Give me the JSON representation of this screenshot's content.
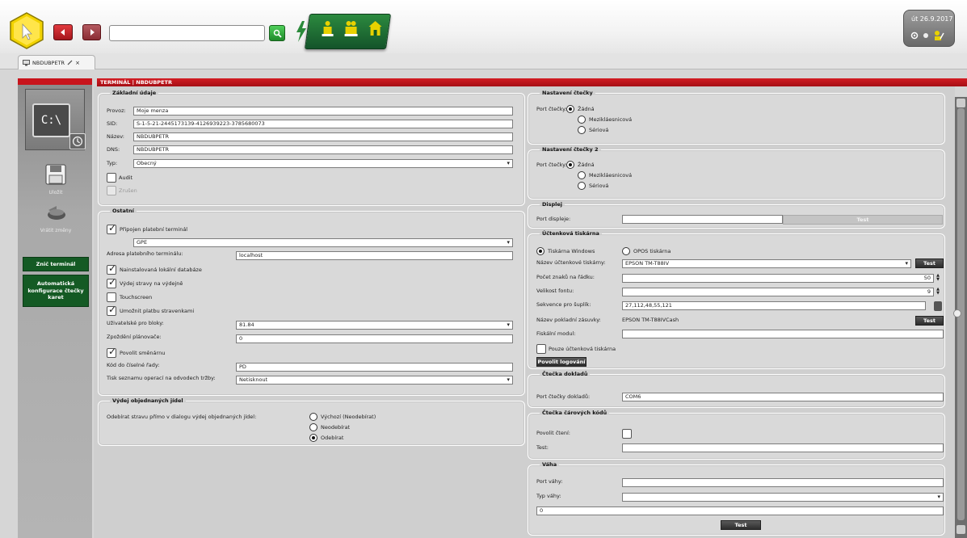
{
  "toolbar": {
    "search_value": ""
  },
  "clock": {
    "date": "út 26.9.2017"
  },
  "tabs": [
    {
      "label": "NBDUBPETR"
    }
  ],
  "sidebar": {
    "terminal_icon_text": "C:\\",
    "save_label": "Uložit",
    "undo_label": "Vrátit změny",
    "own_terminal_label": "Znič terminál",
    "auto_config_label": "Automatická konfigurace čtečky karet"
  },
  "header": {
    "title": "TERMINÁL | NBDUBPETR"
  },
  "basic": {
    "legend": "Základní údaje",
    "provoz_label": "Provoz:",
    "provoz_value": "Moje menza",
    "sid_label": "SID:",
    "sid_value": "S-1-5-21-2445173139-4126939223-3785680073",
    "nazev_label": "Název:",
    "nazev_value": "NBDUBPETR",
    "dns_label": "DNS:",
    "dns_value": "NBDUBPETR",
    "typ_label": "Typ:",
    "typ_value": "Obecný",
    "audit_label": "Audit",
    "zrusen_label": "Zrušen"
  },
  "other": {
    "legend": "Ostatní",
    "payment_label": "Připojen platební terminál",
    "payment_type": "GPE",
    "address_label": "Adresa platebního terminálu:",
    "address_value": "localhost",
    "localdb_label": "Nainstalovaná lokální databáze",
    "issue_label": "Výdej stravy na výdejně",
    "touch_label": "Touchscreen",
    "allow_pay_label": "Umožnit platbu stravenkami",
    "blocks_label": "Uživatelské pro bloky:",
    "blocks_value": "81.84",
    "delay_label": "Zpoždění plánovače:",
    "delay_value": "0",
    "shift_label": "Povolit směnárnu",
    "series_label": "Kód do číselné řady:",
    "series_value": "PD",
    "print_label": "Tisk seznamu operací na odvodech tržby:",
    "print_value": "Netisknout"
  },
  "orders": {
    "legend": "Výdej objednaných jídel",
    "question": "Odebírat stravu přímo v dialogu výdej objednaných jídel:",
    "options": [
      "Výchozí (Neodebírat)",
      "Neodebírat",
      "Odebírat"
    ]
  },
  "reader1": {
    "legend": "Nastavení čtečky",
    "port_label": "Port čtečky:",
    "options": [
      "Žádná",
      "Mezikláesnicová",
      "Sériová"
    ]
  },
  "reader2": {
    "legend": "Nastavení čtečky 2",
    "port_label": "Port čtečky:",
    "options": [
      "Žádná",
      "Mezikláesnicová",
      "Sériová"
    ]
  },
  "display": {
    "legend": "Displej",
    "port_label": "Port displeje:",
    "test_label": "Test"
  },
  "printer": {
    "legend": "Účtenková tiskárna",
    "opt_windows": "Tiskárna Windows",
    "opt_opos": "OPOS tiskárna",
    "name_label": "Název účtenkové tiskárny:",
    "name_value": "EPSON TM-T88IV",
    "test_label": "Test",
    "chars_label": "Počet znaků na řádku:",
    "chars_value": "50",
    "font_label": "Velikost fontu:",
    "font_value": "9",
    "seq_label": "Sekvence pro šuplík:",
    "seq_value": "27,112,48,55,121",
    "drawer_label": "Název pokladní zásuvky:",
    "drawer_value": "EPSON TM-T88IVCash",
    "fiscal_label": "Fiskální modul:",
    "only_label": "Pouze účtenková tiskárna",
    "logo_label": "Povolit logování"
  },
  "doc_reader": {
    "legend": "Čtečka dokladů",
    "port_label": "Port čtečky dokladů:",
    "port_value": "COM6"
  },
  "barcode": {
    "legend": "Čtečka čárových kódů",
    "allow_label": "Povolit čtení:",
    "test_label": "Test:"
  },
  "scale": {
    "legend": "Váha",
    "port_label": "Port váhy:",
    "type_label": "Typ váhy:",
    "extra_value": "0",
    "test_label": "Test"
  },
  "colors": {
    "accent": "#c8141c",
    "dark_green": "#145a24"
  }
}
